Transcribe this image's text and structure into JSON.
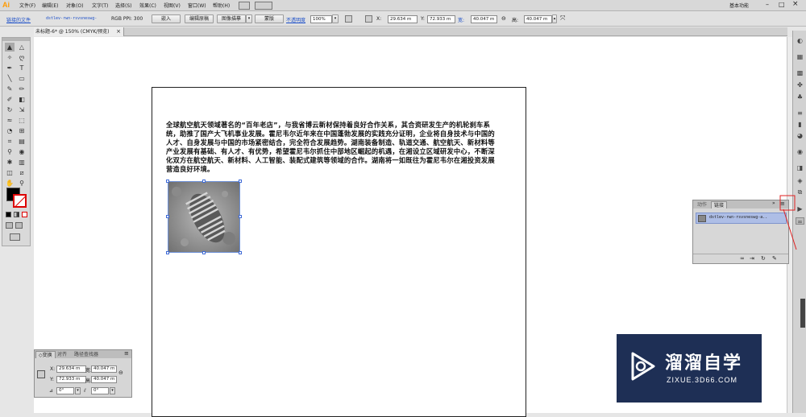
{
  "app": {
    "logo": "Ai",
    "workspace": "基本功能"
  },
  "menu": {
    "items": [
      "文件(F)",
      "编辑(E)",
      "对象(O)",
      "文字(T)",
      "选择(S)",
      "效果(C)",
      "视图(V)",
      "窗口(W)",
      "帮助(H)"
    ]
  },
  "controlbar": {
    "linked_file_label": "链接的文件",
    "filename": "dstlev-rwn-rsvsneswg-",
    "ppi_label": "RGB PPI: 300",
    "embed_button": "嵌入",
    "edit_original_button": "编辑原稿",
    "image_trace_button": "图像描摹",
    "mask_button": "蒙版",
    "opacity_label": "不透明度",
    "opacity_value": "100%",
    "x_label": "X:",
    "x_value": "29.634 m",
    "y_label": "Y:",
    "y_value": "72.933 m",
    "w_label": "宽:",
    "w_value": "40.047 m",
    "h_label": "高:",
    "h_value": "40.047 m"
  },
  "document": {
    "tab_title": "未标题-6* @ 150% (CMYK/预览)",
    "close_icon": "×"
  },
  "content": {
    "paragraph": "全球航空航天领域著名的“百年老店”，与我省博云新材保持着良好合作关系，其合资研发生产的机轮刹车系统，助推了国产大飞机事业发展。霍尼韦尔近年来在中国蓬勃发展的实践充分证明，企业将自身技术与中国的人才、自身发展与中国的市场紧密结合，完全符合发展趋势。湖南装备制造、轨道交通、航空航天、新材料等产业发展有基础、有人才、有优势，希望霍尼韦尔抓住中部地区崛起的机遇，在湘设立区域研发中心，不断深化双方在航空航天、新材料、人工智能、装配式建筑等领域的合作。湖南将一如既往为霍尼韦尔在湘投资发展营造良好环境。"
  },
  "links_panel": {
    "tabs": [
      "动作",
      "链接"
    ],
    "active_tab": "链接",
    "items": [
      {
        "name": "dstlev-rwn-rsvsneswg-a.."
      }
    ]
  },
  "transform_panel": {
    "tabs": [
      "◇变换",
      "对齐",
      "路径查找器"
    ],
    "x_label": "X:",
    "x_value": "29.634 m",
    "y_label": "Y:",
    "y_value": "72.933 m",
    "w_label": "宽:",
    "w_value": "40.047 m",
    "h_label": "高:",
    "h_value": "40.047 m",
    "angle_value": "0°",
    "shear_value": "0°"
  },
  "watermark": {
    "title": "溜溜自学",
    "url": "ZIXUE.3D66.COM"
  },
  "colors": {
    "accent": "#ff9a00",
    "selection": "#6c8fd6",
    "watermark_bg": "#1e2f55",
    "annotation": "#e02020"
  }
}
